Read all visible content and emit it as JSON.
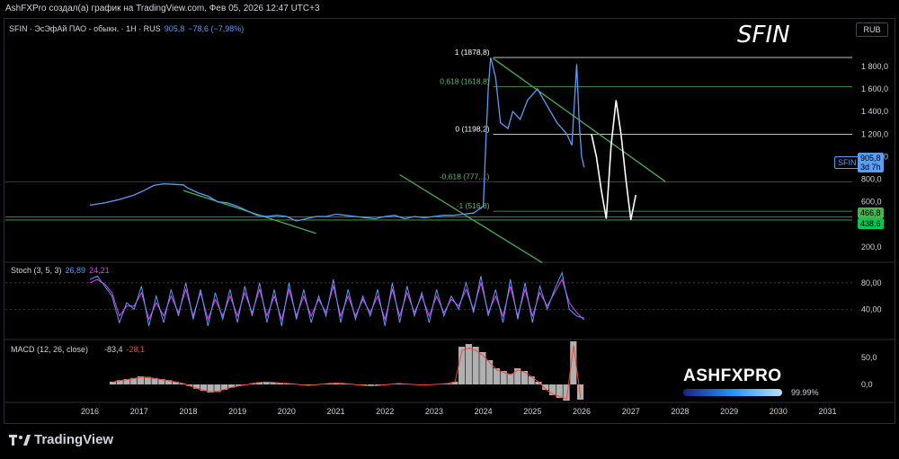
{
  "header": {
    "attribution": "AshFXPro создал(а) график на TradingView.com, Фев 05, 2026 12:47 UTC+3"
  },
  "symbol": {
    "legend_prefix": "SFIN · ЭсЭфАй ПАО - обыкн. · 1Н · RUS",
    "last": "905,8",
    "change": "−78,6 (−7,98%)",
    "big_label": "SFIN",
    "currency_badge": "RUB",
    "price_tag_name": "SFIN",
    "price_tag_value": "905,8",
    "price_tag_time": "3d 7h",
    "green_tag_1": "466,8",
    "green_tag_2": "438,6"
  },
  "fib_labels": [
    {
      "text": "1 (1878,8)",
      "value": 1878.8
    },
    {
      "text": "0,618 (1618,8)",
      "value": 1618.8
    },
    {
      "text": "0 (1198,2)",
      "value": 1198.2
    },
    {
      "text": "-0,618 (777,...)",
      "value": 777.5
    },
    {
      "text": "-1 (516,8)",
      "value": 516.8
    }
  ],
  "stoch": {
    "title": "Stoch (3, 5, 3)",
    "k": "26,89",
    "d": "24,21"
  },
  "macd": {
    "title": "MACD (12, 26, close)",
    "v1": "-83,4",
    "v2": "-28,1"
  },
  "watermark": {
    "brand": "ASHFXPRO",
    "pct": "99.99%"
  },
  "footer": {
    "logo_text": "TradingView"
  },
  "colors": {
    "price": "#5b9cf6",
    "projection": "#ffffff",
    "trend": "#4caf50",
    "stoch_k": "#5b9cf6",
    "stoch_d": "#e040fb",
    "macd_line": "#f44336",
    "hist": "#b0b0b0"
  },
  "chart_data": [
    {
      "type": "line",
      "title": "SFIN · ЭсЭфАй ПАО - обыкн. · 1Н · RUS",
      "xlabel": "",
      "ylabel": "",
      "x_ticks": [
        "2016",
        "2017",
        "2018",
        "2019",
        "2020",
        "2021",
        "2022",
        "2023",
        "2024",
        "2025",
        "2026",
        "2027",
        "2028",
        "2029",
        "2030",
        "2031"
      ],
      "y_ticks": [
        "200,0",
        "400,0",
        "600,0",
        "800,0",
        "1 000,0",
        "1 200,0",
        "1 400,0",
        "1 600,0",
        "1 800,0"
      ],
      "ylim": [
        80,
        1990
      ],
      "series": [
        {
          "values": [
            [
              2016.0,
              570
            ],
            [
              2016.3,
              590
            ],
            [
              2016.6,
              620
            ],
            [
              2016.9,
              660
            ],
            [
              2017.1,
              700
            ],
            [
              2017.3,
              745
            ],
            [
              2017.5,
              760
            ],
            [
              2017.7,
              755
            ],
            [
              2017.9,
              750
            ],
            [
              2018.0,
              720
            ],
            [
              2018.2,
              680
            ],
            [
              2018.4,
              650
            ],
            [
              2018.6,
              600
            ],
            [
              2018.8,
              590
            ],
            [
              2019.0,
              560
            ],
            [
              2019.2,
              520
            ],
            [
              2019.4,
              480
            ],
            [
              2019.6,
              470
            ],
            [
              2019.8,
              480
            ],
            [
              2020.0,
              470
            ],
            [
              2020.2,
              430
            ],
            [
              2020.4,
              450
            ],
            [
              2020.6,
              470
            ],
            [
              2020.8,
              470
            ],
            [
              2021.0,
              490
            ],
            [
              2021.2,
              480
            ],
            [
              2021.4,
              470
            ],
            [
              2021.6,
              460
            ],
            [
              2021.8,
              450
            ],
            [
              2022.0,
              470
            ],
            [
              2022.2,
              480
            ],
            [
              2022.4,
              450
            ],
            [
              2022.6,
              470
            ],
            [
              2022.8,
              460
            ],
            [
              2023.0,
              470
            ],
            [
              2023.2,
              480
            ],
            [
              2023.4,
              480
            ],
            [
              2023.6,
              490
            ],
            [
              2023.8,
              500
            ],
            [
              2023.9,
              530
            ],
            [
              2024.0,
              560
            ],
            [
              2024.05,
              1100
            ],
            [
              2024.1,
              1600
            ],
            [
              2024.15,
              1878.8
            ],
            [
              2024.25,
              1700
            ],
            [
              2024.35,
              1300
            ],
            [
              2024.5,
              1250
            ],
            [
              2024.6,
              1400
            ],
            [
              2024.75,
              1330
            ],
            [
              2024.9,
              1500
            ],
            [
              2025.1,
              1600
            ],
            [
              2025.3,
              1450
            ],
            [
              2025.5,
              1300
            ],
            [
              2025.7,
              1200
            ],
            [
              2025.8,
              1100
            ],
            [
              2025.9,
              1820
            ],
            [
              2025.95,
              1300
            ],
            [
              2026.0,
              1000
            ],
            [
              2026.05,
              905.8
            ]
          ]
        },
        {
          "values": [
            [
              2026.2,
              1200
            ],
            [
              2026.3,
              1000
            ],
            [
              2026.4,
              700
            ],
            [
              2026.5,
              450
            ],
            [
              2026.6,
              1100
            ],
            [
              2026.7,
              1500
            ],
            [
              2026.8,
              1200
            ],
            [
              2026.9,
              800
            ],
            [
              2027.0,
              438.6
            ],
            [
              2027.1,
              660
            ]
          ]
        }
      ]
    },
    {
      "type": "line",
      "title": "Stoch (3, 5, 3)",
      "y_ticks": [
        "40,00",
        "80,00"
      ],
      "ylim": [
        0,
        100
      ],
      "series": [
        {
          "values": [
            85,
            90,
            75,
            60,
            20,
            50,
            40,
            75,
            15,
            60,
            20,
            70,
            30,
            80,
            25,
            70,
            15,
            65,
            25,
            70,
            20,
            75,
            30,
            80,
            20,
            70,
            15,
            80,
            25,
            70,
            20,
            60,
            30,
            85,
            20,
            70,
            25,
            60,
            30,
            70,
            15,
            80,
            20,
            75,
            30,
            65,
            20,
            70,
            30,
            60,
            40,
            80,
            35,
            90,
            30,
            70,
            20,
            85,
            25,
            80,
            20,
            75,
            40,
            70,
            95,
            40,
            30,
            26.89
          ]
        },
        {
          "values": [
            80,
            85,
            78,
            65,
            30,
            45,
            45,
            65,
            25,
            50,
            30,
            60,
            35,
            70,
            30,
            65,
            25,
            55,
            30,
            60,
            30,
            65,
            35,
            70,
            30,
            60,
            25,
            70,
            30,
            60,
            30,
            55,
            35,
            75,
            30,
            60,
            30,
            55,
            35,
            60,
            25,
            70,
            30,
            65,
            35,
            60,
            30,
            60,
            35,
            55,
            45,
            70,
            40,
            80,
            35,
            60,
            30,
            75,
            30,
            70,
            30,
            65,
            45,
            65,
            85,
            50,
            35,
            24.21
          ]
        }
      ]
    },
    {
      "type": "bar",
      "title": "MACD (12, 26, close)",
      "y_ticks": [
        "0,0",
        "50,0"
      ],
      "ylim": [
        -30,
        80
      ],
      "values": [
        5,
        8,
        10,
        12,
        15,
        14,
        12,
        10,
        8,
        5,
        2,
        -3,
        -8,
        -12,
        -15,
        -14,
        -10,
        -6,
        -3,
        -1,
        2,
        4,
        5,
        4,
        3,
        2,
        1,
        -1,
        -2,
        -1,
        1,
        2,
        3,
        2,
        1,
        -1,
        -2,
        -3,
        -2,
        -1,
        1,
        2,
        1,
        0,
        -1,
        -1,
        0,
        1,
        2,
        5,
        70,
        75,
        70,
        60,
        45,
        30,
        25,
        20,
        30,
        25,
        15,
        5,
        -10,
        -20,
        -25,
        -30,
        80,
        -28.1
      ]
    }
  ]
}
